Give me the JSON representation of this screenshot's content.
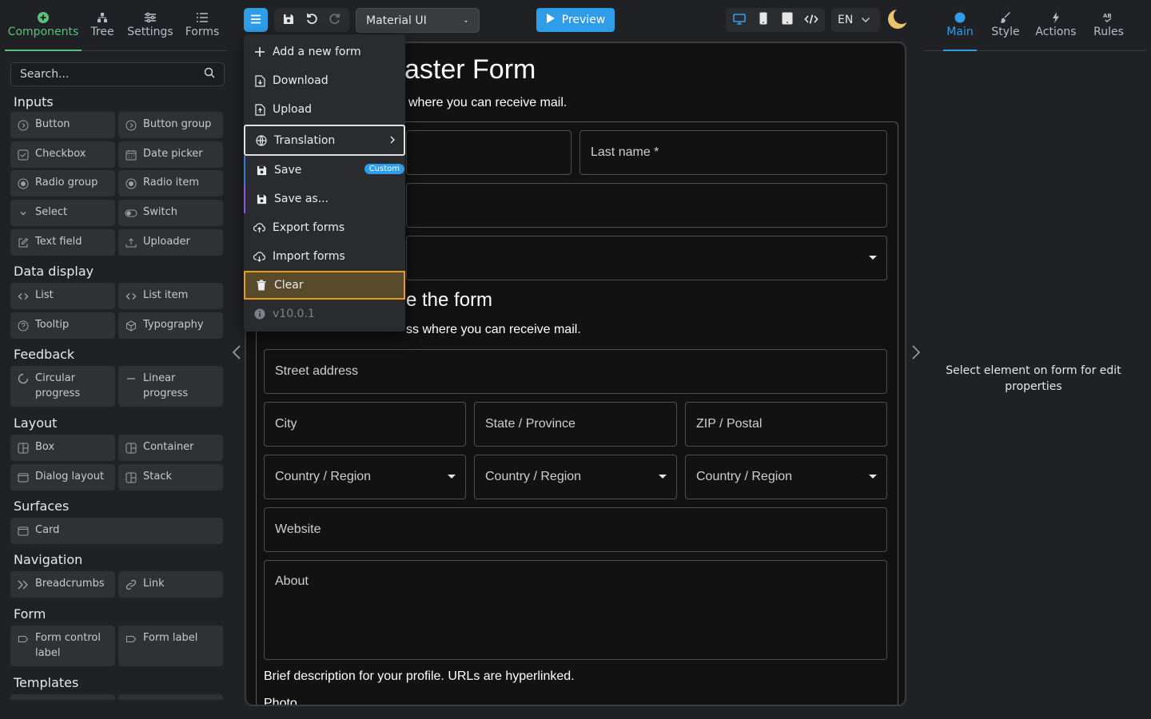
{
  "left_tabs": [
    {
      "label": "Components",
      "icon": "plus-circle-icon"
    },
    {
      "label": "Tree",
      "icon": "tree-icon"
    },
    {
      "label": "Settings",
      "icon": "sliders-icon"
    },
    {
      "label": "Forms",
      "icon": "list-icon"
    }
  ],
  "search": {
    "placeholder": "Search..."
  },
  "sections": {
    "inputs": "Inputs",
    "data_display": "Data display",
    "feedback": "Feedback",
    "layout": "Layout",
    "surfaces": "Surfaces",
    "navigation": "Navigation",
    "form": "Form",
    "templates": "Templates"
  },
  "components": {
    "button": "Button",
    "button_group": "Button group",
    "checkbox": "Checkbox",
    "date_picker": "Date picker",
    "radio_group": "Radio group",
    "radio_item": "Radio item",
    "select": "Select",
    "switch": "Switch",
    "text_field": "Text field",
    "uploader": "Uploader",
    "list": "List",
    "list_item": "List item",
    "tooltip": "Tooltip",
    "typography": "Typography",
    "circular_progress": "Circular progress",
    "linear_progress": "Linear progress",
    "box": "Box",
    "container": "Container",
    "dialog_layout": "Dialog layout",
    "stack": "Stack",
    "card": "Card",
    "breadcrumbs": "Breadcrumbs",
    "link": "Link",
    "form_control_label": "Form control label",
    "form_label": "Form label"
  },
  "toolbar": {
    "ui_library": "Material UI",
    "preview_label": "Preview",
    "language": "EN"
  },
  "menu": {
    "add_new_form": "Add a new form",
    "download": "Download",
    "upload": "Upload",
    "translation": "Translation",
    "save": "Save",
    "save_badge": "Custom",
    "save_as": "Save as...",
    "export_forms": "Export forms",
    "import_forms": "Import forms",
    "clear": "Clear",
    "version": "v10.0.1"
  },
  "form": {
    "title_visible": "aster Form",
    "subtitle_visible": "where you can receive mail.",
    "last_name": "Last name *",
    "section2_title_visible": "e the form",
    "section2_sub_visible": "ss where you can receive mail.",
    "street_address": "Street address",
    "city": "City",
    "state": "State / Province",
    "zip": "ZIP / Postal",
    "country1": "Country / Region",
    "country2": "Country / Region",
    "country3": "Country / Region",
    "website": "Website",
    "about": "About",
    "about_help": "Brief description for your profile. URLs are hyperlinked.",
    "photo": "Photo"
  },
  "right_tabs": [
    {
      "label": "Main",
      "icon": "circle-icon"
    },
    {
      "label": "Style",
      "icon": "brush-icon"
    },
    {
      "label": "Actions",
      "icon": "bolt-icon"
    },
    {
      "label": "Rules",
      "icon": "ab-icon"
    }
  ],
  "right_panel": {
    "hint": "Select element on form for edit properties"
  },
  "colors": {
    "accent": "#2f9de8",
    "components_tab": "#58c27d",
    "clear_highlight": "#e89b19"
  }
}
